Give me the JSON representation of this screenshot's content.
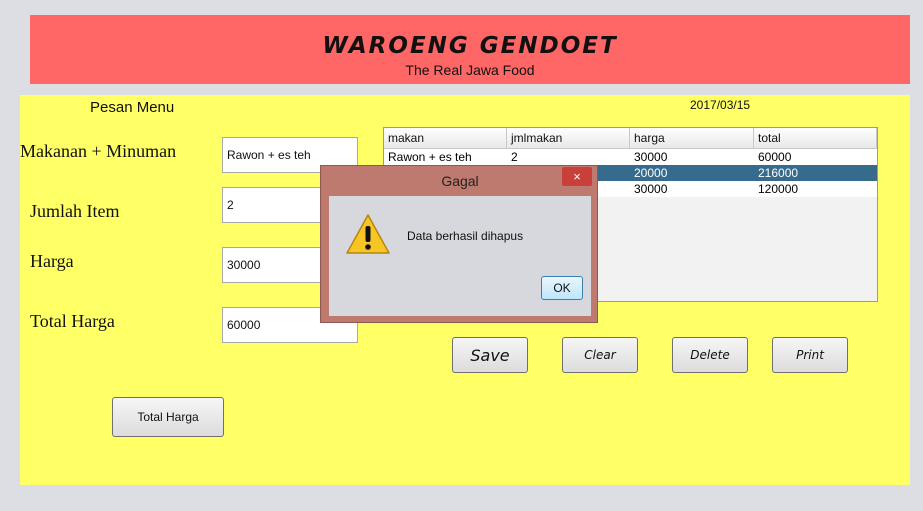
{
  "header": {
    "title": "WAROENG GENDOET",
    "subtitle": "The Real Jawa Food"
  },
  "form": {
    "section_title": "Pesan Menu",
    "date": "2017/03/15",
    "makanan_label": "Makanan + Minuman",
    "makanan_value": "Rawon + es teh",
    "jumlah_label": "Jumlah Item",
    "jumlah_value": "2",
    "harga_label": "Harga",
    "harga_value": "30000",
    "total_label": "Total Harga",
    "total_value": "60000",
    "total_button": "Total Harga"
  },
  "table": {
    "columns": [
      "makan",
      "jmlmakan",
      "harga",
      "total"
    ],
    "rows": [
      [
        "Rawon + es teh",
        "2",
        "30000",
        "60000"
      ],
      [
        "",
        "",
        "20000",
        "216000"
      ],
      [
        "",
        "",
        "30000",
        "120000"
      ]
    ]
  },
  "actions": {
    "save": "Save",
    "clear": "Clear",
    "delete": "Delete",
    "print": "Print"
  },
  "dialog": {
    "title": "Gagal",
    "close": "×",
    "message": "Data berhasil dihapus",
    "ok": "OK",
    "icon": "warning-icon"
  }
}
